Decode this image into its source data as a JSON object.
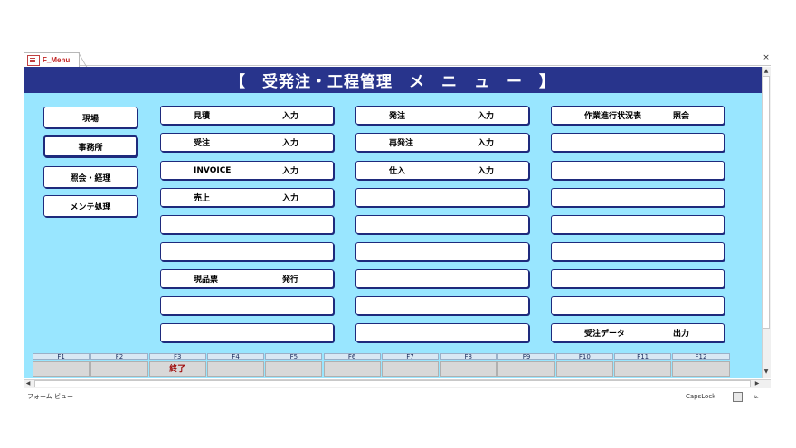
{
  "tab": {
    "label": "F_Menu",
    "close": "×"
  },
  "header": {
    "title": "【　受発注・工程管理　メ　ニ　ュ　ー　】"
  },
  "side_buttons": [
    {
      "label": "現場"
    },
    {
      "label": "事務所",
      "active": true
    },
    {
      "label": "照会・経理"
    },
    {
      "label": "メンテ処理"
    }
  ],
  "columns": [
    [
      {
        "l1": "見積",
        "l2": "入力"
      },
      {
        "l1": "受注",
        "l2": "入力"
      },
      {
        "l1": "INVOICE",
        "l2": "入力"
      },
      {
        "l1": "売上",
        "l2": "入力"
      },
      {
        "l1": "",
        "l2": ""
      },
      {
        "l1": "",
        "l2": ""
      },
      {
        "l1": "現品票",
        "l2": "発行"
      },
      {
        "l1": "",
        "l2": ""
      },
      {
        "l1": "",
        "l2": ""
      }
    ],
    [
      {
        "l1": "発注",
        "l2": "入力"
      },
      {
        "l1": "再発注",
        "l2": "入力"
      },
      {
        "l1": "仕入",
        "l2": "入力"
      },
      {
        "l1": "",
        "l2": ""
      },
      {
        "l1": "",
        "l2": ""
      },
      {
        "l1": "",
        "l2": ""
      },
      {
        "l1": "",
        "l2": ""
      },
      {
        "l1": "",
        "l2": ""
      },
      {
        "l1": "",
        "l2": ""
      }
    ],
    [
      {
        "l1": "作業進行状況表",
        "l2": "照会"
      },
      {
        "l1": "",
        "l2": ""
      },
      {
        "l1": "",
        "l2": ""
      },
      {
        "l1": "",
        "l2": ""
      },
      {
        "l1": "",
        "l2": ""
      },
      {
        "l1": "",
        "l2": ""
      },
      {
        "l1": "",
        "l2": ""
      },
      {
        "l1": "",
        "l2": ""
      },
      {
        "l1": "受注データ",
        "l2": "出力"
      }
    ]
  ],
  "function_keys": [
    {
      "key": "F1",
      "value": ""
    },
    {
      "key": "F2",
      "value": ""
    },
    {
      "key": "F3",
      "value": "終了"
    },
    {
      "key": "F4",
      "value": ""
    },
    {
      "key": "F5",
      "value": ""
    },
    {
      "key": "F6",
      "value": ""
    },
    {
      "key": "F7",
      "value": ""
    },
    {
      "key": "F8",
      "value": ""
    },
    {
      "key": "F9",
      "value": ""
    },
    {
      "key": "F10",
      "value": ""
    },
    {
      "key": "F11",
      "value": ""
    },
    {
      "key": "F12",
      "value": ""
    }
  ],
  "status": {
    "view": "フォーム ビュー",
    "capslock": "CapsLock"
  },
  "colors": {
    "header": "#28348c",
    "form_bg": "#99e6ff",
    "button_border": "#1e2a7c",
    "fkey_text": "#a01010"
  }
}
